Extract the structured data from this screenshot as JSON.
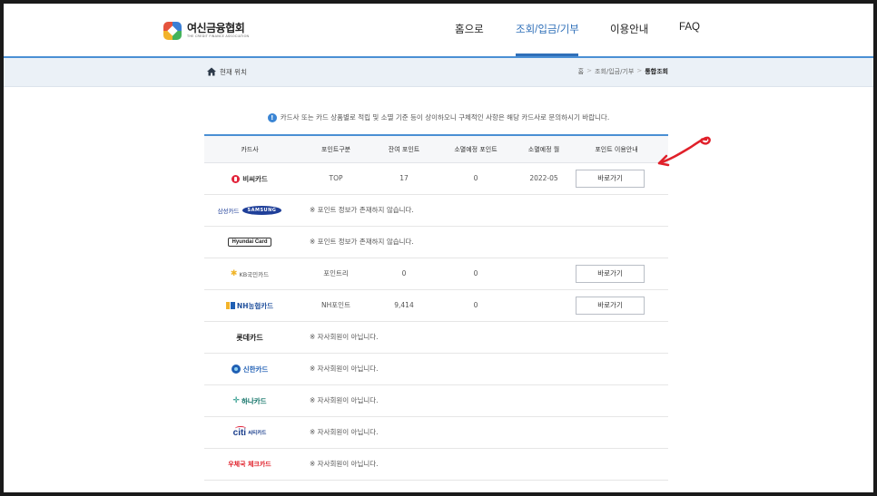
{
  "header": {
    "logo_name": "여신금융협회",
    "logo_sub": "THE CREDIT FINANCE ASSOCIATION",
    "nav": [
      "홈으로",
      "조회/입금/기부",
      "이용안내",
      "FAQ"
    ],
    "active_nav": "조회/입금/기부"
  },
  "breadcrumb": {
    "label": "현재 위치",
    "path": [
      "홈",
      "조회/입금/기부",
      "통합조회"
    ]
  },
  "notice": "카드사 또는 카드 상품별로 적립 및 소멸 기준 등이 상이하오니 구체적인 사항은 해당 카드사로 문의하시기 바랍니다.",
  "table": {
    "headers": [
      "카드사",
      "포인트구분",
      "잔여 포인트",
      "소멸예정 포인트",
      "소멸예정 월",
      "포인트 이용안내"
    ],
    "button_label": "바로가기",
    "rows": [
      {
        "brand": "비씨카드",
        "type": "TOP",
        "balance": "17",
        "expiring": "0",
        "month": "2022-05",
        "button": true
      },
      {
        "brand": "삼성카드",
        "brand_sub": "SAMSUNG",
        "message": "※ 포인트 정보가 존재하지 않습니다."
      },
      {
        "brand": "Hyundai Card",
        "message": "※ 포인트 정보가 존재하지 않습니다."
      },
      {
        "brand": "KB국민카드",
        "type": "포인트리",
        "balance": "0",
        "expiring": "0",
        "button": true
      },
      {
        "brand": "NH농협카드",
        "type": "NH포인트",
        "balance": "9,414",
        "expiring": "0",
        "button": true
      },
      {
        "brand": "롯데카드",
        "message": "※ 자사회원이 아닙니다."
      },
      {
        "brand": "신한카드",
        "message": "※ 자사회원이 아닙니다."
      },
      {
        "brand": "하나카드",
        "message": "※ 자사회원이 아닙니다."
      },
      {
        "brand": "씨티카드",
        "message": "※ 자사회원이 아닙니다."
      },
      {
        "brand": "우체국 체크카드",
        "message": "※ 자사회원이 아닙니다."
      }
    ]
  },
  "colors": {
    "accent": "#2f6fb8",
    "header_line": "#4a8fd4",
    "crumb_bg": "#ebf1f7",
    "annotation": "#e0202a"
  }
}
